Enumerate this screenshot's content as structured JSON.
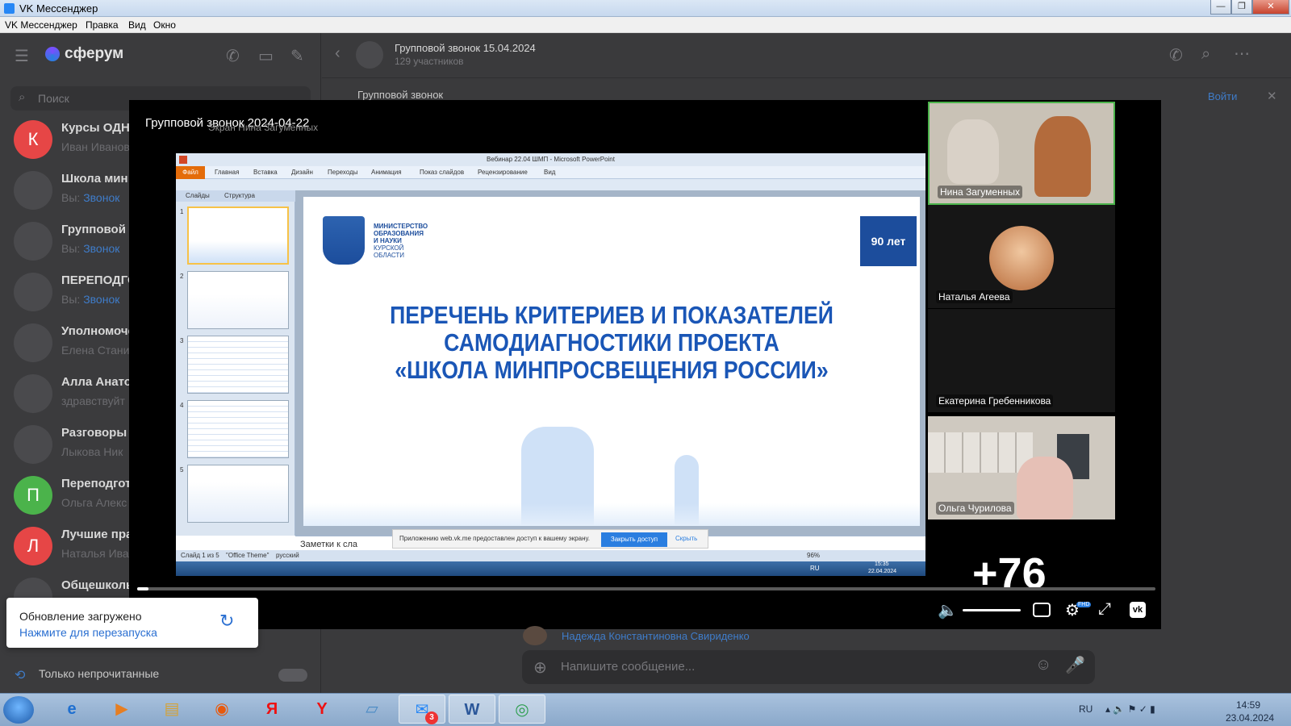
{
  "window": {
    "title": "VK Мессенджер",
    "buttons": {
      "minimize": "—",
      "restore": "❐",
      "close": "✕"
    }
  },
  "menu": [
    "VK Мессенджер",
    "Правка",
    "Вид",
    "Окно"
  ],
  "sidebar": {
    "brand": "сферум",
    "search_placeholder": "Поиск",
    "chats": [
      {
        "name": "Курсы ОДНК",
        "sub": "Иван Иванов",
        "avatar": "К",
        "color": "#e64646"
      },
      {
        "name": "Школа мин",
        "sub_prefix": "Вы: ",
        "sub_link": "Звонок",
        "avatar": ""
      },
      {
        "name": "Групповой з",
        "sub_prefix": "Вы: ",
        "sub_link": "Звонок",
        "avatar": ""
      },
      {
        "name": "ПЕРЕПОДГО",
        "sub_prefix": "Вы: ",
        "sub_link": "Звонок",
        "avatar": ""
      },
      {
        "name": "Уполномоче",
        "sub": "Елена Стани",
        "avatar": ""
      },
      {
        "name": "Алла Анатол",
        "sub": "здравствуйт",
        "avatar": ""
      },
      {
        "name": "Разговоры о",
        "sub": "Лыкова Ник",
        "avatar": ""
      },
      {
        "name": "Переподгот",
        "sub": "Ольга Алекс",
        "avatar": "П",
        "color": "#4bb34b"
      },
      {
        "name": "Лучшие пра",
        "sub": "Наталья Ива",
        "avatar": "Л",
        "color": "#e64646"
      },
      {
        "name": "Общешколь",
        "sub": "",
        "avatar": ""
      }
    ],
    "unread_only": "Только непрочитанные"
  },
  "chat_header": {
    "title": "Групповой звонок 15.04.2024",
    "members": "129 участников",
    "pinned": "Групповой звонок",
    "join_button": "Войти"
  },
  "call": {
    "title": "Групповой звонок 2024-04-22",
    "screen_owner": "Экран Нина Загуменных",
    "participants": [
      {
        "name": "Нина Загуменных"
      },
      {
        "name": "Наталья Агеева"
      },
      {
        "name": "Екатерина Гребенникова"
      },
      {
        "name": "Ольга Чурилова"
      }
    ],
    "more_count": "+76",
    "hd_badge": "FHD"
  },
  "powerpoint": {
    "window_title": "Вебинар 22.04 ШМП - Microsoft PowerPoint",
    "file_tab": "Файл",
    "ribbon_tabs": [
      "Главная",
      "Вставка",
      "Дизайн",
      "Переходы",
      "Анимация",
      "Показ слайдов",
      "Рецензирование",
      "Вид"
    ],
    "panel_tabs": [
      "Слайды",
      "Структура"
    ],
    "thumb_numbers": [
      "1",
      "2",
      "3",
      "4",
      "5"
    ],
    "ministry": [
      "МИНИСТЕРСТВО",
      "ОБРАЗОВАНИЯ",
      "И НАУКИ",
      "КУРСКОЙ",
      "ОБЛАСТИ"
    ],
    "logo_text": "90 лет",
    "slide_title_lines": [
      "ПЕРЕЧЕНЬ КРИТЕРИЕВ И ПОКАЗАТЕЛЕЙ",
      "САМОДИАГНОСТИКИ ПРОЕКТА",
      "«ШКОЛА МИНПРОСВЕЩЕНИЯ РОССИИ»"
    ],
    "notes": "Заметки к сла",
    "status": [
      "Слайд 1 из 5",
      "\"Office Theme\"",
      "русский"
    ],
    "zoom": "96%",
    "share_bar": {
      "text": "Приложению web.vk.me предоставлен доступ к вашему экрану.",
      "stop": "Закрыть доступ",
      "hide": "Скрыть"
    },
    "tray_lang": "RU",
    "tray_time": "15:35",
    "tray_date": "22.04.2024"
  },
  "composer": {
    "placeholder": "Напишите сообщение...",
    "last_sender": "Надежда Константиновна Свириденко"
  },
  "toast": {
    "line1": "Обновление загружено",
    "line2": "Нажмите для перезапуска"
  },
  "taskbar": {
    "apps": [
      "ie-icon",
      "media-icon",
      "folder-icon",
      "firefox-icon",
      "yandex-icon",
      "yabrowser-icon",
      "notepad-icon",
      "vk-messenger-icon",
      "word-icon",
      "chrome-icon"
    ],
    "messenger_badge": "3",
    "lang": "RU",
    "time": "14:59",
    "date": "23.04.2024"
  },
  "colors": {
    "accent": "#2a7ee0",
    "speaker_border": "#4bb34b",
    "slide_title": "#1a56b6"
  }
}
